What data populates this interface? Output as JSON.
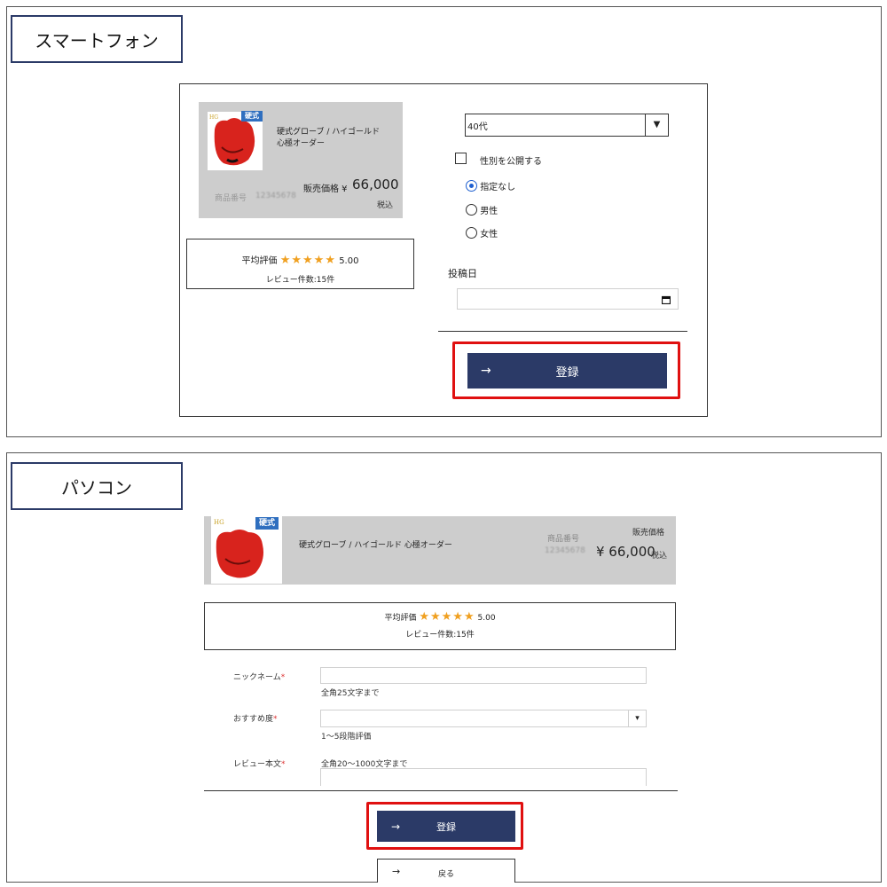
{
  "smartphone": {
    "section_label": "スマートフォン",
    "product": {
      "badge": "硬式",
      "name_line1": "硬式グローブ / ハイゴールド",
      "name_line2": "心極オーダー",
      "price_label": "販売価格 ¥",
      "price": "66,000",
      "tax": "税込",
      "code_label": "商品番号",
      "code_value": "12345678"
    },
    "rating": {
      "label": "平均評価",
      "stars": "★★★★★",
      "score": "5.00",
      "count_text": "レビュー件数:15件"
    },
    "age_select": {
      "value": "40代",
      "arrow": "▼"
    },
    "gender_public": {
      "label": "性別を公開する",
      "checked": false
    },
    "gender_options": [
      {
        "label": "指定なし",
        "selected": true
      },
      {
        "label": "男性",
        "selected": false
      },
      {
        "label": "女性",
        "selected": false
      }
    ],
    "post_date": {
      "label": "投稿日",
      "value": "",
      "icon": "calendar-icon"
    },
    "submit": {
      "arrow": "→",
      "label": "登録"
    }
  },
  "pc": {
    "section_label": "パソコン",
    "product": {
      "badge": "硬式",
      "name": "硬式グローブ / ハイゴールド 心極オーダー",
      "code_label": "商品番号",
      "code_value": "12345678",
      "price_label": "販売価格",
      "price": "¥ 66,000",
      "tax": "税込"
    },
    "rating": {
      "label": "平均評価",
      "stars": "★★★★★",
      "score": "5.00",
      "count_text": "レビュー件数:15件"
    },
    "form": {
      "nickname": {
        "label": "ニックネーム",
        "required": "*",
        "value": "",
        "hint": "全角25文字まで"
      },
      "recommend": {
        "label": "おすすめ度",
        "required": "*",
        "value": "",
        "arrow": "▾",
        "hint": "1～5段階評価"
      },
      "review": {
        "label": "レビュー本文",
        "required": "*",
        "hint": "全角20～1000文字まで",
        "value": ""
      }
    },
    "submit": {
      "arrow": "→",
      "label": "登録"
    },
    "back": {
      "arrow": "→",
      "label": "戻る"
    }
  },
  "colors": {
    "navy": "#2b3a67",
    "highlight": "#e01010",
    "star": "#f0a020",
    "product_bg": "#cdcdcd"
  }
}
